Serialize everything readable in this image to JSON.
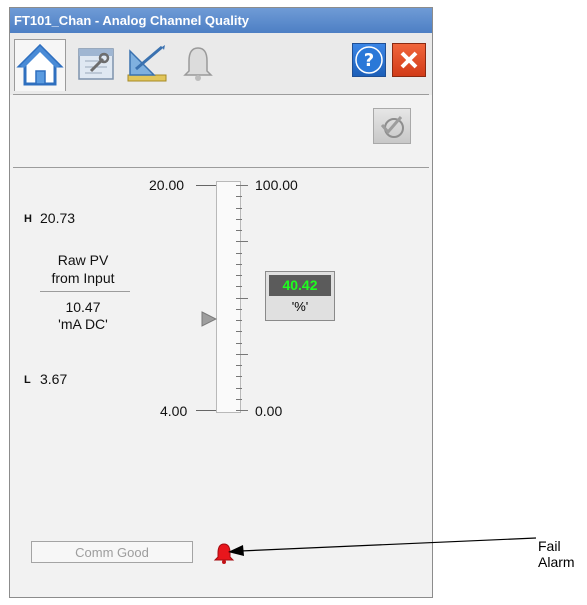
{
  "window": {
    "title": "FT101_Chan - Analog Channel Quality"
  },
  "tabs": [
    {
      "name": "home",
      "icon": "home-icon",
      "active": true
    },
    {
      "name": "maintenance",
      "icon": "maintenance-icon",
      "active": false
    },
    {
      "name": "engineering",
      "icon": "engineering-icon",
      "active": false
    },
    {
      "name": "alarms",
      "icon": "bell-icon",
      "active": false
    }
  ],
  "scale": {
    "raw_top": "20.00",
    "raw_bottom": "4.00",
    "eu_top": "100.00",
    "eu_bottom": "0.00"
  },
  "raw": {
    "high_label": "H",
    "high_value": "20.73",
    "title_line1": "Raw PV",
    "title_line2": "from Input",
    "value": "10.47",
    "units": "'mA DC'",
    "low_label": "L",
    "low_value": "3.67"
  },
  "pv": {
    "value": "40.42",
    "units": "'%'",
    "value_color": "#1eff1e",
    "level": 0.4042
  },
  "status": {
    "comm": "Comm Good"
  },
  "annotation": {
    "label": "Fail Alarm"
  }
}
